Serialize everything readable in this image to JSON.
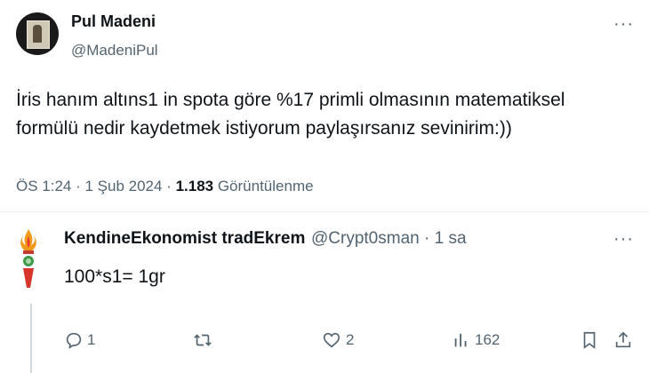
{
  "author": {
    "name": "Pul Madeni",
    "handle": "@MadeniPul"
  },
  "tweet": {
    "text": "İris hanım altıns1 in spota göre %17 primli olmasının matematiksel\nformülü nedir kaydetmek istiyorum paylaşırsanız sevinirim:))",
    "time": "ÖS 1:24 · 1 Şub 2024 · ",
    "views_count": "1.183",
    "views_label": " Görüntülenme"
  },
  "reply": {
    "name": "KendineEkonomist tradEkrem",
    "handle_time": "@Crypt0sman · 1 sa",
    "text": "100*s1= 1gr",
    "reply_count": "1",
    "like_count": "2",
    "view_count": "162"
  },
  "icons": {
    "more": "more-dots-icon",
    "reply": "reply-bubble-icon",
    "retweet": "retweet-icon",
    "like": "heart-icon",
    "views": "views-bars-icon",
    "bookmark": "bookmark-icon",
    "share": "share-icon"
  },
  "colors": {
    "text": "#0f1419",
    "secondary": "#536471",
    "divider": "#eff3f4"
  }
}
